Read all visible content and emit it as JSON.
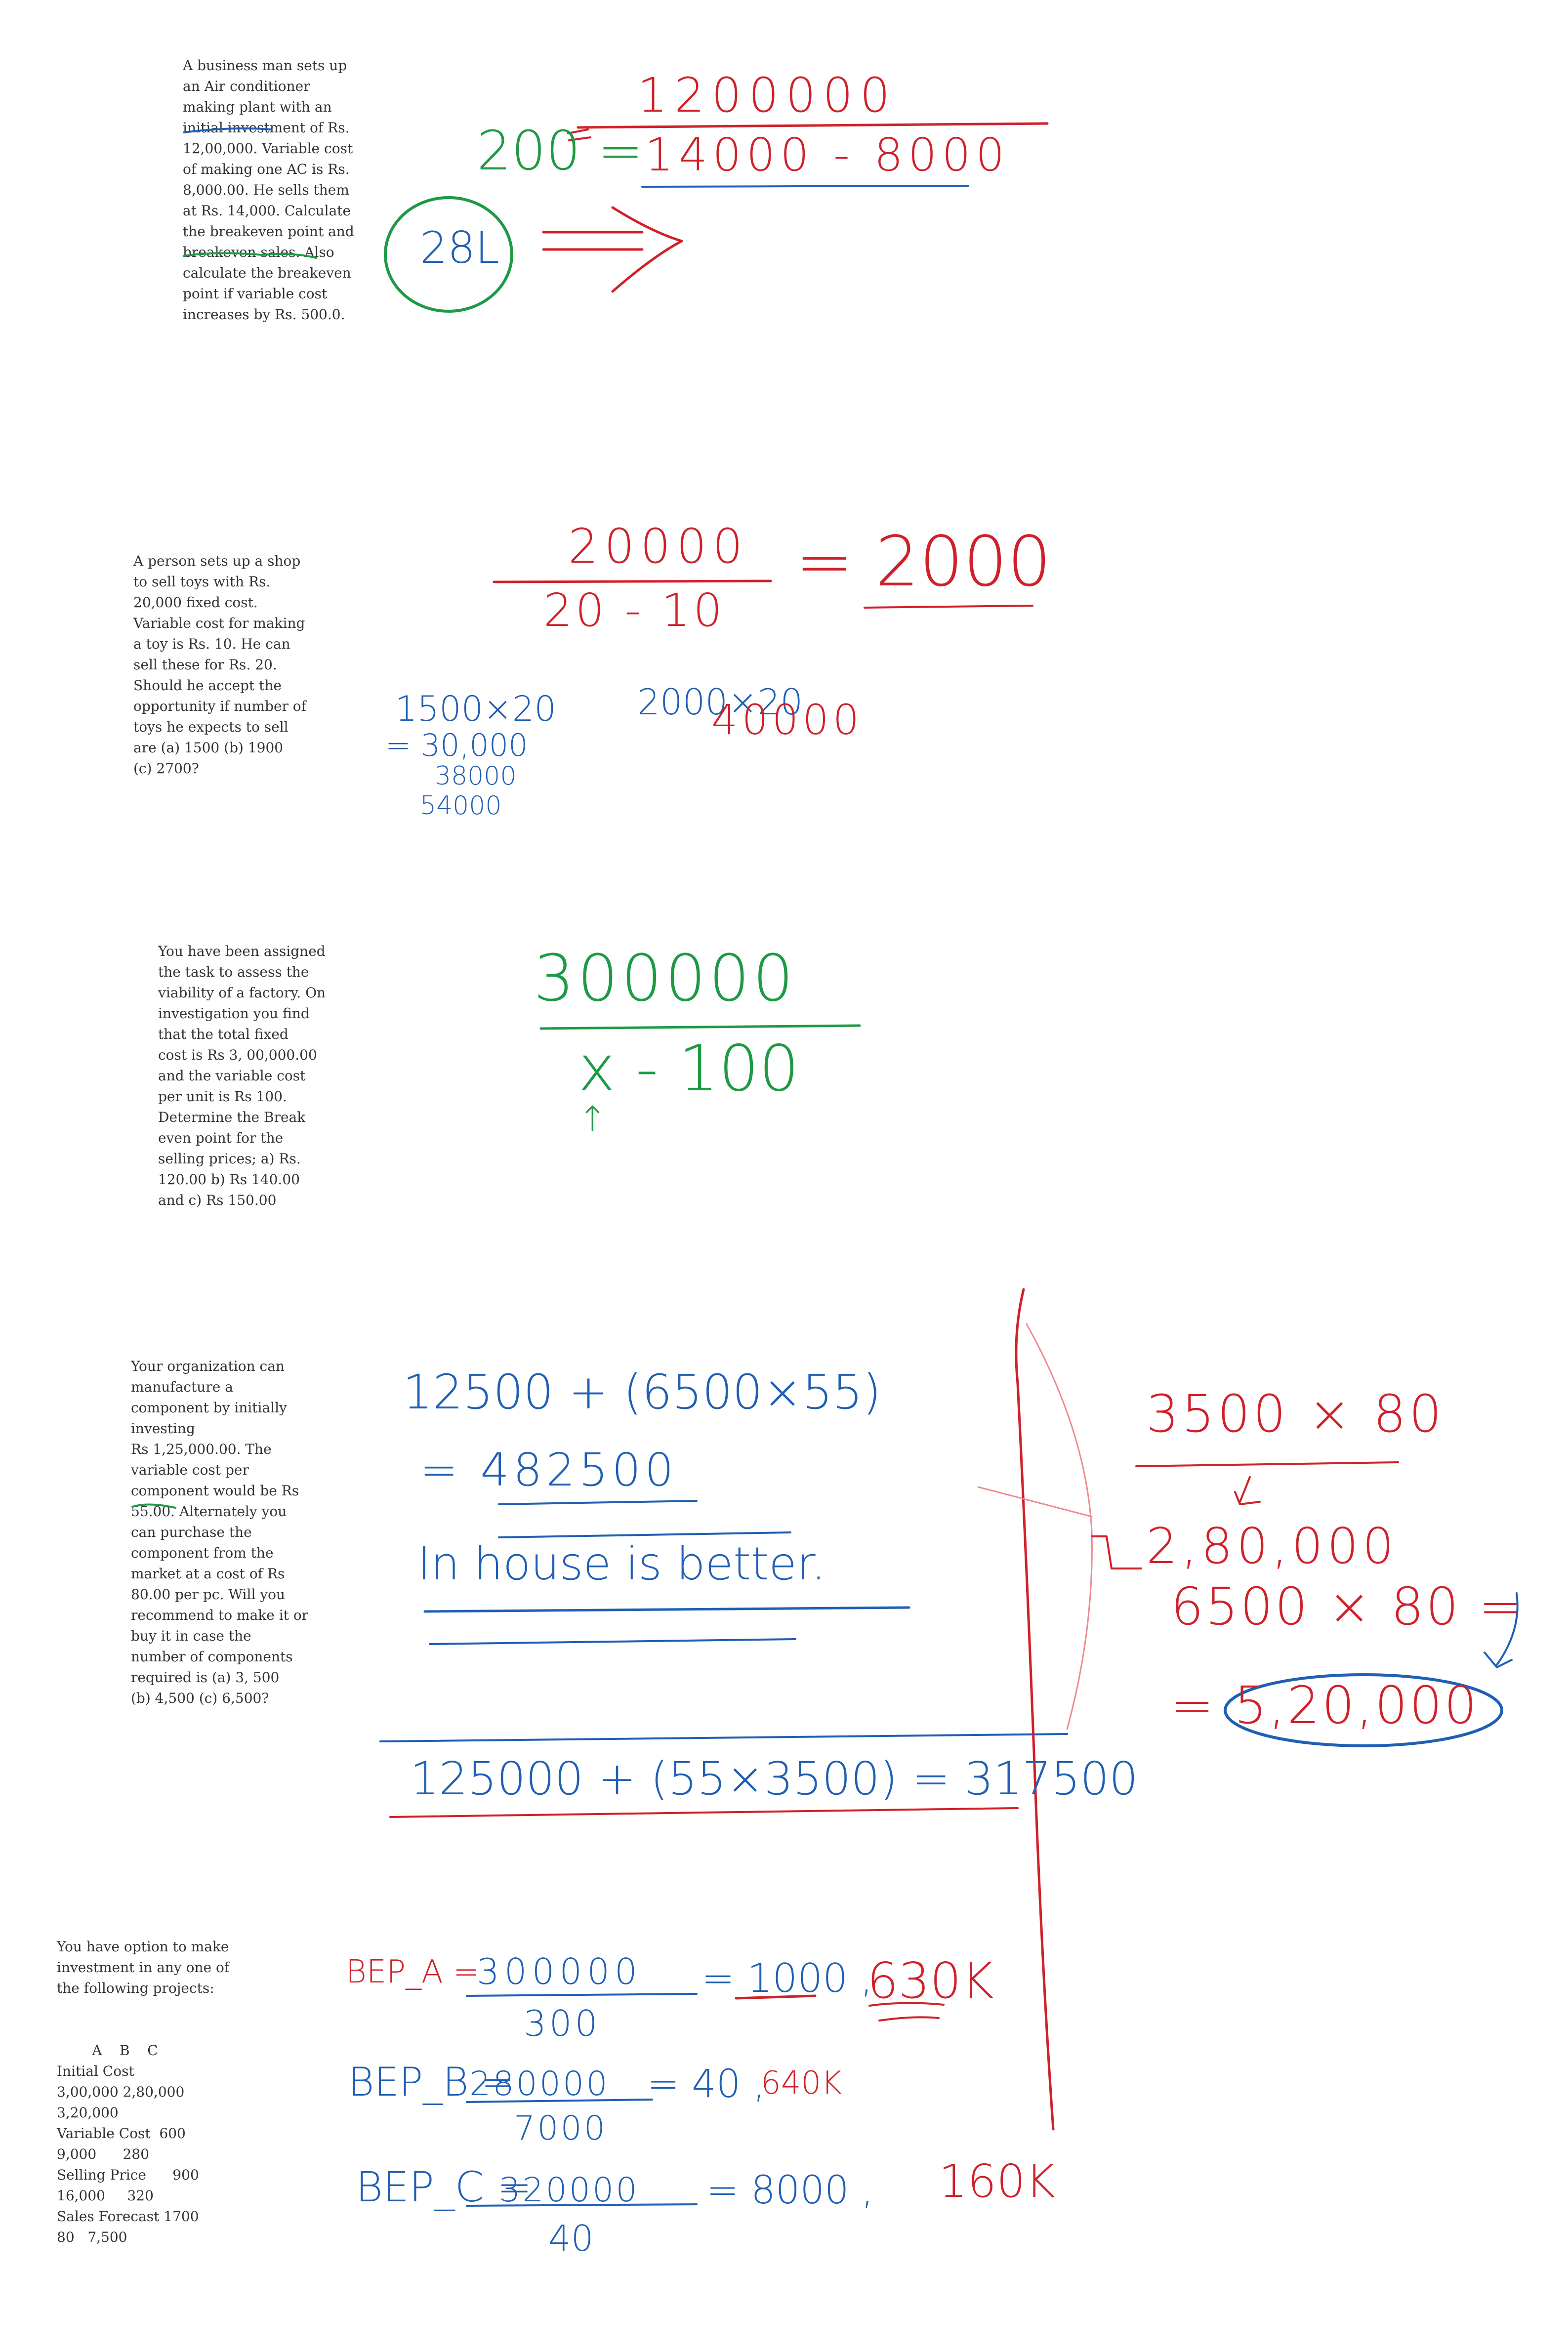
{
  "problems": [
    {
      "text": "A business man sets up\nan Air conditioner\nmaking plant with an\ninitial investment of Rs.\n12,00,000. Variable cost\nof making one AC is Rs.\n8,000.00. He sells them\nat Rs. 14,000. Calculate\nthe breakeven point and\nbreakeven sales. Also\ncalculate the breakeven\npoint if variable cost\nincreases by Rs. 500.0."
    },
    {
      "text": "A person sets up a shop\nto sell toys with Rs.\n20,000 fixed cost.\nVariable cost for making\na toy is Rs. 10. He can\nsell these for Rs. 20.\nShould he accept the\nopportunity if number of\ntoys he expects to sell\nare (a) 1500 (b) 1900\n(c) 2700?"
    },
    {
      "text": "You have been assigned\nthe task to assess the\nviability of a factory. On\ninvestigation you find\nthat the total fixed\ncost is Rs 3, 00,000.00\nand the variable cost\nper unit is Rs 100.\nDetermine the Break\neven point for the\nselling prices; a) Rs.\n120.00 b) Rs 140.00\nand c) Rs 150.00"
    },
    {
      "text": "Your organization can\nmanufacture a\ncomponent by initially\ninvesting\nRs 1,25,000.00. The\nvariable cost per\ncomponent would be Rs\n55.00. Alternately you\ncan purchase the\ncomponent from the\nmarket at a cost of Rs\n80.00 per pc. Will you\nrecommend to make it or\nbuy it in case the\nnumber of components\nrequired is (a) 3, 500\n(b) 4,500 (c) 6,500?"
    },
    {
      "text": "You have option to make\ninvestment in any one of\nthe following projects:\n\n\n        A    B    C\nInitial Cost\n3,00,000 2,80,000\n3,20,000\nVariable Cost  600\n9,000      280\nSelling Price      900\n16,000     320\nSales Forecast 1700\n80   7,500"
    }
  ],
  "annotations": {
    "p1": {
      "top": "1200000",
      "left": "200 =",
      "bottom": "14000  - 8000",
      "circled": "28L"
    },
    "p2": {
      "top": "20000",
      "bottom": "20 - 10",
      "result": "= 2000",
      "calc1": "1500×20",
      "calc2": "= 30,000",
      "calc3": "38000",
      "calc4": "54000",
      "calc5": "2000×20",
      "calc6": "40000"
    },
    "p3": {
      "top": "300000",
      "bottom": "x - 100",
      "mark": "↑"
    },
    "p4": {
      "line1": "12500 + (6500×55)",
      "line2": "= 482500",
      "line3": "In house is better.",
      "line4": "125000 + (55×3500) = 317500",
      "right1": "3500 × 80",
      "right2": "2,80,000",
      "right3": "6500 × 80 =",
      "right4": "= 5,20,000"
    },
    "p5": {
      "a_label": "BEP_A =",
      "a_top": "300000",
      "a_bottom": "300",
      "a_result": "= 1000 ,",
      "a_sales": "630K",
      "b_label": "BEP_B =",
      "b_top": "280000",
      "b_bottom": "7000",
      "b_result": "= 40 ,",
      "b_sales": "640K",
      "c_label": "BEP_C =",
      "c_top": "320000",
      "c_bottom": "40",
      "c_result": "= 8000 ,",
      "c_sales": "160K"
    }
  }
}
